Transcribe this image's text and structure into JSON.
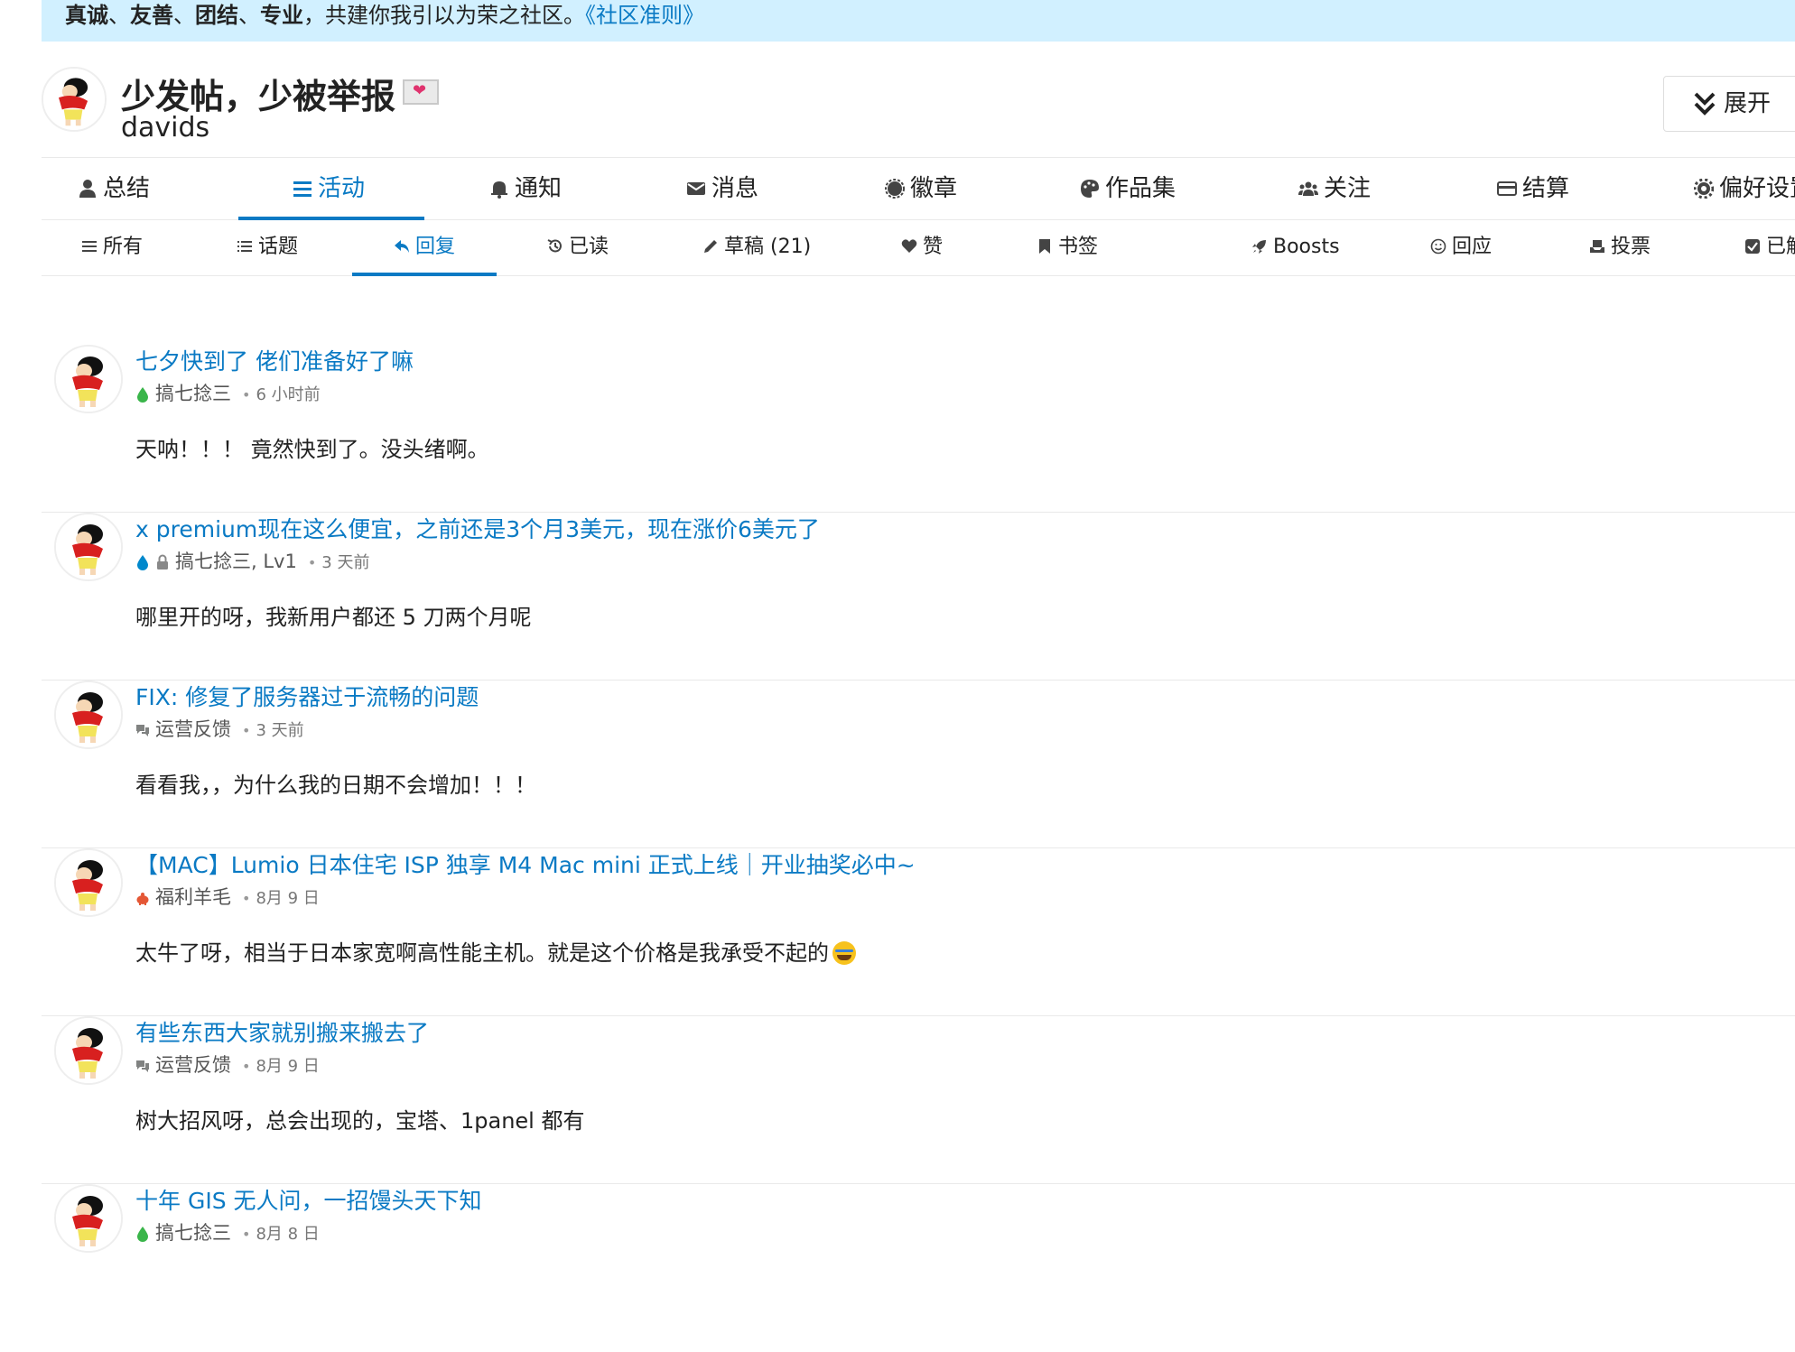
{
  "banner": {
    "w1": "真诚",
    "s1": "、",
    "w2": "友善",
    "s2": "、",
    "w3": "团结",
    "s3": "、",
    "w4": "专业",
    "rest": "，共建你我引以为荣之社区。",
    "link": "《社区准则》"
  },
  "user": {
    "name": "少发帖，少被举报",
    "handle": "davids",
    "expand_label": "展开"
  },
  "main_tabs": [
    {
      "label": "总结",
      "icon": "user-icon"
    },
    {
      "label": "活动",
      "icon": "list-icon"
    },
    {
      "label": "通知",
      "icon": "bell-icon"
    },
    {
      "label": "消息",
      "icon": "envelope-icon"
    },
    {
      "label": "徽章",
      "icon": "certificate-icon"
    },
    {
      "label": "作品集",
      "icon": "palette-icon"
    },
    {
      "label": "关注",
      "icon": "users-icon"
    },
    {
      "label": "结算",
      "icon": "credit-card-icon"
    },
    {
      "label": "偏好设置",
      "icon": "gear-icon"
    }
  ],
  "sub_tabs": [
    {
      "label": "所有",
      "icon": "bars-icon"
    },
    {
      "label": "话题",
      "icon": "list-ul-icon"
    },
    {
      "label": "回复",
      "icon": "reply-icon"
    },
    {
      "label": "已读",
      "icon": "history-icon"
    },
    {
      "label": "草稿 (21)",
      "icon": "pencil-icon"
    },
    {
      "label": "赞",
      "icon": "heart-icon"
    },
    {
      "label": "书签",
      "icon": "bookmark-icon"
    },
    {
      "label": "Boosts",
      "icon": "rocket-icon"
    },
    {
      "label": "回应",
      "icon": "smile-icon"
    },
    {
      "label": "投票",
      "icon": "inbox-icon"
    },
    {
      "label": "已解决",
      "icon": "check-square-icon"
    }
  ],
  "active_main_tab": "活动",
  "active_sub_tab": "回复",
  "colors": {
    "accent": "#0a7ac4",
    "banner_bg": "#d1f0ff",
    "category_green": "#3ab54a",
    "category_blue": "#0088cc",
    "category_gray": "#808281",
    "category_red": "#e45735"
  },
  "posts": [
    {
      "title": "七夕快到了 佬们准备好了嘛",
      "category": "搞七捻三",
      "category_icon": "droplet-green-icon",
      "time": "6 小时前",
      "excerpt": "天呐！！！ 竟然快到了。没头绪啊。"
    },
    {
      "title": "x premium现在这么便宜，之前还是3个月3美元，现在涨价6美元了",
      "category": "搞七捻三, Lv1",
      "category_icon": "droplet-blue-icon",
      "locked": true,
      "time": "3 天前",
      "excerpt": "哪里开的呀，我新用户都还 5 刀两个月呢"
    },
    {
      "title": "FIX: 修复了服务器过于流畅的问题",
      "category": "运营反馈",
      "category_icon": "comments-icon",
      "time": "3 天前",
      "excerpt": "看看我，，为什么我的日期不会增加！！！"
    },
    {
      "title": "【MAC】Lumio 日本住宅 ISP 独享 M4 Mac mini 正式上线｜开业抽奖必中~",
      "category": "福利羊毛",
      "category_icon": "piggy-bank-icon",
      "time": "8月 9 日",
      "excerpt": "太牛了呀，相当于日本家宽啊高性能主机。就是这个价格是我承受不起的",
      "excerpt_emoji": "joy-emoji-icon"
    },
    {
      "title": "有些东西大家就别搬来搬去了",
      "category": "运营反馈",
      "category_icon": "comments-icon",
      "time": "8月 9 日",
      "excerpt": "树大招风呀，总会出现的，宝塔、1panel 都有"
    },
    {
      "title": "十年 GIS 无人问，一招馒头天下知",
      "category": "搞七捻三",
      "category_icon": "droplet-green-icon",
      "time": "8月 8 日",
      "excerpt": ""
    }
  ]
}
